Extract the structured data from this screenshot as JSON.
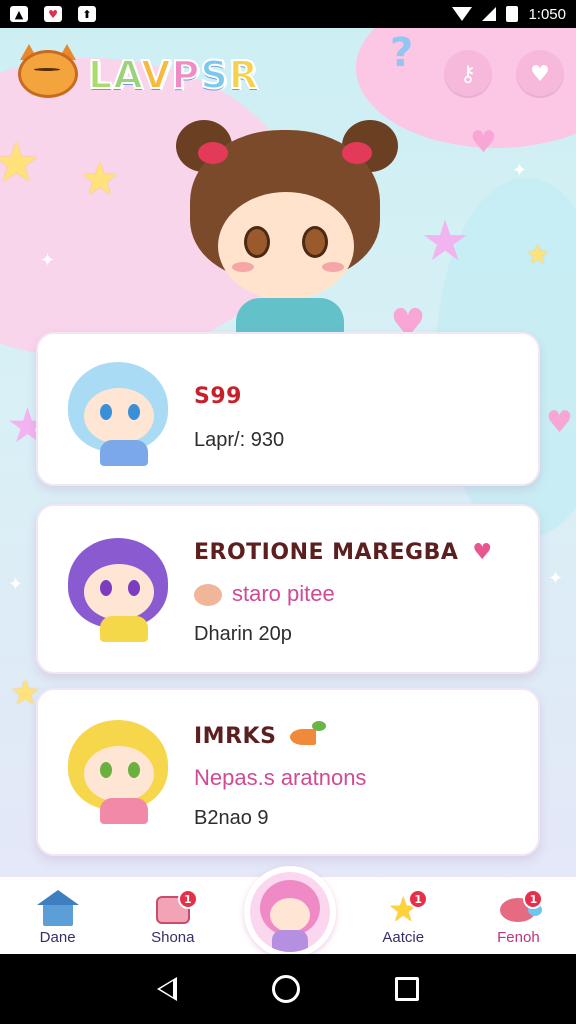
{
  "status_bar": {
    "time": "1:050"
  },
  "header": {
    "logo_letters": [
      "L",
      "A",
      "V",
      "P",
      "S",
      "R"
    ],
    "buttons": [
      {
        "icon": "key-icon"
      },
      {
        "icon": "heart-icon"
      }
    ]
  },
  "cards": [
    {
      "title": "S99",
      "line2": "",
      "meta": "Lapr/: 930"
    },
    {
      "title": "EROTIONE MAREGBA",
      "line2": "staro pitee",
      "meta": "Dharin 20p"
    },
    {
      "title": "IMRKS",
      "line2": "Nepas.s aratnons",
      "meta": "B2nao 9"
    }
  ],
  "bottom_nav": {
    "items": [
      {
        "label": "Dane",
        "icon": "home-icon",
        "badge": ""
      },
      {
        "label": "Shona",
        "icon": "shop-icon",
        "badge": "1"
      },
      {
        "label": "Aatcie",
        "icon": "star-icon",
        "badge": "1"
      },
      {
        "label": "Fenoh",
        "icon": "fish-icon",
        "badge": "1"
      }
    ]
  },
  "colors": {
    "accent_pink": "#f6b9dc",
    "title_red": "#c8202a",
    "sub_pink": "#d04a94"
  }
}
